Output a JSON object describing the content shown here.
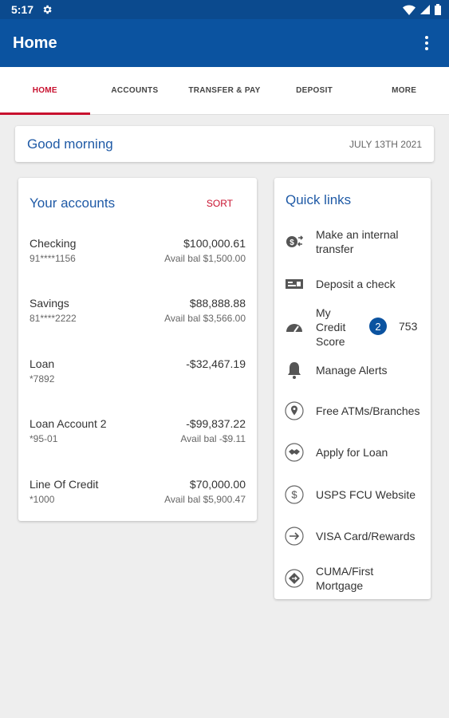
{
  "status_bar": {
    "time": "5:17"
  },
  "app_bar": {
    "title": "Home"
  },
  "tabs": [
    {
      "label": "HOME",
      "active": true
    },
    {
      "label": "ACCOUNTS",
      "active": false
    },
    {
      "label": "TRANSFER & PAY",
      "active": false
    },
    {
      "label": "DEPOSIT",
      "active": false
    },
    {
      "label": "MORE",
      "active": false
    }
  ],
  "greeting": {
    "text": "Good morning",
    "date": "JULY 13TH 2021"
  },
  "accounts": {
    "title": "Your accounts",
    "sort_label": "SORT",
    "items": [
      {
        "name": "Checking",
        "number": "91****1156",
        "balance": "$100,000.61",
        "avail": "Avail bal $1,500.00"
      },
      {
        "name": "Savings",
        "number": "81****2222",
        "balance": "$88,888.88",
        "avail": "Avail bal $3,566.00"
      },
      {
        "name": "Loan",
        "number": "*7892",
        "balance": "-$32,467.19",
        "avail": ""
      },
      {
        "name": "Loan Account 2",
        "number": "*95-01",
        "balance": "-$99,837.22",
        "avail": "Avail bal -$9.11"
      },
      {
        "name": "Line Of Credit",
        "number": "*1000",
        "balance": "$70,000.00",
        "avail": "Avail bal $5,900.47"
      }
    ]
  },
  "quick_links": {
    "title": "Quick links",
    "items": [
      {
        "label": "Make an internal\ntransfer",
        "icon": "transfer-icon"
      },
      {
        "label": "Deposit a check",
        "icon": "check-deposit-icon"
      },
      {
        "label": "My\nCredit\nScore",
        "icon": "gauge-icon",
        "badge": "2",
        "score": "753"
      },
      {
        "label": "Manage Alerts",
        "icon": "bell-icon"
      },
      {
        "label": "Free ATMs/Branches",
        "icon": "location-pin-icon"
      },
      {
        "label": "Apply for Loan",
        "icon": "handshake-icon"
      },
      {
        "label": "USPS FCU Website",
        "icon": "dollar-circle-icon"
      },
      {
        "label": "VISA Card/Rewards",
        "icon": "arrow-right-circle-icon"
      },
      {
        "label": "CUMA/First\nMortgage",
        "icon": "mortgage-icon"
      }
    ]
  },
  "colors": {
    "primary": "#0b53a0",
    "status_bar": "#0b4a8e",
    "accent_red": "#c8102e",
    "link_blue": "#1f5aa6"
  }
}
